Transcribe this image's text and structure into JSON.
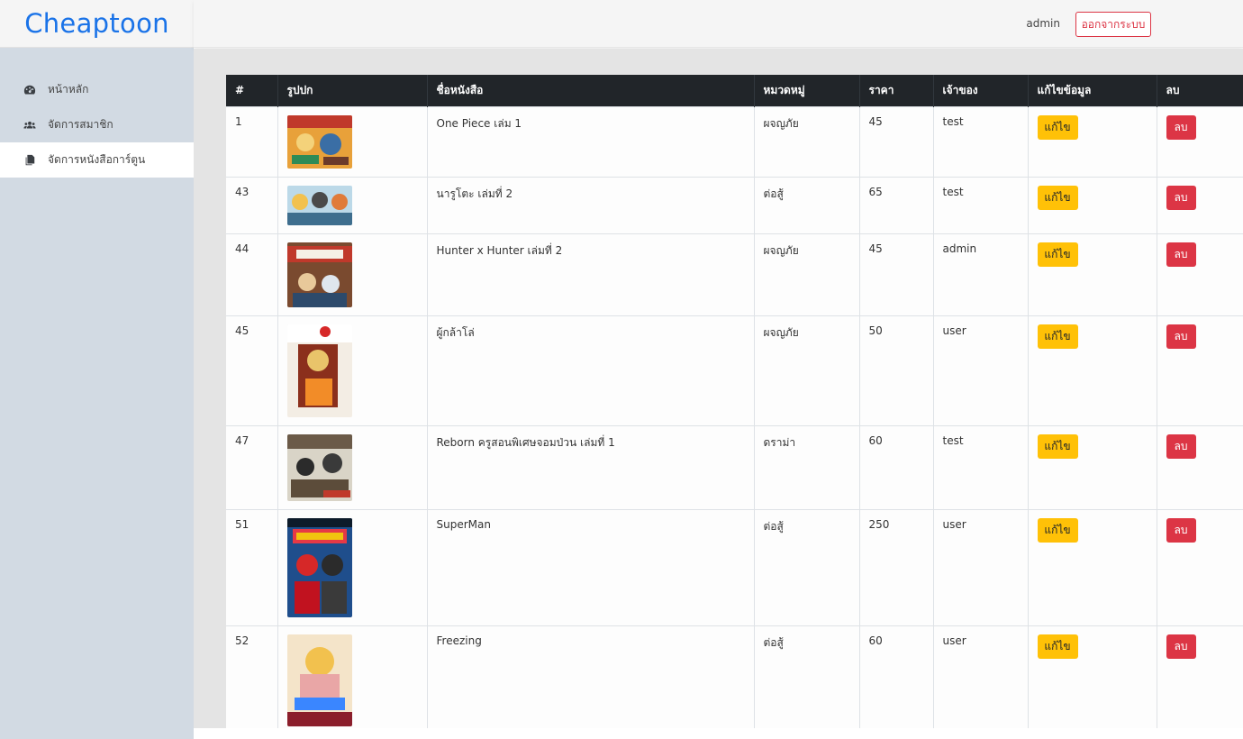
{
  "brand": {
    "name": "Cheaptoon",
    "color": "#1a73e8"
  },
  "header": {
    "username": "admin",
    "logout_label": "ออกจากระบบ"
  },
  "sidebar": {
    "items": [
      {
        "label": "หน้าหลัก",
        "icon": "dashboard-icon",
        "active": false
      },
      {
        "label": "จัดการสมาชิก",
        "icon": "users-icon",
        "active": false
      },
      {
        "label": "จัดการหนังสือการ์ตูน",
        "icon": "copy-icon",
        "active": true
      }
    ]
  },
  "table": {
    "headers": {
      "id": "#",
      "cover": "รูปปก",
      "title": "ชื่อหนังสือ",
      "category": "หมวดหมู่",
      "price": "ราคา",
      "owner": "เจ้าของ",
      "edit": "แก้ไขข้อมูล",
      "delete": "ลบ"
    },
    "edit_label": "แก้ไข",
    "delete_label": "ลบ",
    "rows": [
      {
        "id": "1",
        "title": "One Piece เล่ม 1",
        "category": "ผจญภัย",
        "price": "45",
        "owner": "test"
      },
      {
        "id": "43",
        "title": "นารูโตะ เล่มที่ 2",
        "category": "ต่อสู้",
        "price": "65",
        "owner": "test"
      },
      {
        "id": "44",
        "title": "Hunter x Hunter เล่มที่ 2",
        "category": "ผจญภัย",
        "price": "45",
        "owner": "admin"
      },
      {
        "id": "45",
        "title": "ผู้กล้าโล่",
        "category": "ผจญภัย",
        "price": "50",
        "owner": "user"
      },
      {
        "id": "47",
        "title": "Reborn ครูสอนพิเศษจอมป่วน เล่มที่ 1",
        "category": "ดราม่า",
        "price": "60",
        "owner": "test"
      },
      {
        "id": "51",
        "title": "SuperMan",
        "category": "ต่อสู้",
        "price": "250",
        "owner": "user"
      },
      {
        "id": "52",
        "title": "Freezing",
        "category": "ต่อสู้",
        "price": "60",
        "owner": "user"
      }
    ]
  },
  "colors": {
    "edit_button": "#ffc107",
    "delete_button": "#dc3545",
    "table_header": "#212529",
    "sidebar_bg": "#d2dae3"
  }
}
